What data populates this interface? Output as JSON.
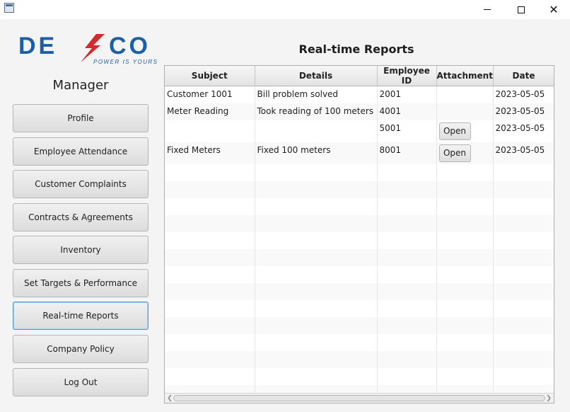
{
  "window": {
    "min_glyph": "",
    "close_glyph": "✕"
  },
  "logo": {
    "text_de": "DE",
    "text_co": "CO",
    "tagline": "POWER IS YOURS",
    "colors": {
      "blue": "#1a5fa8",
      "red": "#d6282d"
    }
  },
  "sidebar": {
    "title": "Manager",
    "items": [
      {
        "label": "Profile"
      },
      {
        "label": "Employee Attendance"
      },
      {
        "label": "Customer Complaints"
      },
      {
        "label": "Contracts & Agreements"
      },
      {
        "label": "Inventory"
      },
      {
        "label": "Set Targets & Performance"
      },
      {
        "label": "Real-time Reports",
        "active": true
      },
      {
        "label": "Company Policy"
      },
      {
        "label": "Log Out"
      }
    ]
  },
  "main": {
    "title": "Real-time Reports",
    "table": {
      "columns": [
        "Subject",
        "Details",
        "Employee ID",
        "Attachment",
        "Date"
      ],
      "rows": [
        {
          "subject": "Customer 1001",
          "details": "Bill problem solved",
          "employee_id": "2001",
          "attachment": "",
          "date": "2023-05-05"
        },
        {
          "subject": "Meter Reading",
          "details": "Took reading of 100 meters",
          "employee_id": "4001",
          "attachment": "",
          "date": "2023-05-05"
        },
        {
          "subject": "",
          "details": "",
          "employee_id": "5001",
          "attachment": "Open",
          "date": "2023-05-05"
        },
        {
          "subject": "Fixed Meters",
          "details": "Fixed 100 meters",
          "employee_id": "8001",
          "attachment": "Open",
          "date": "2023-05-05"
        }
      ]
    }
  }
}
